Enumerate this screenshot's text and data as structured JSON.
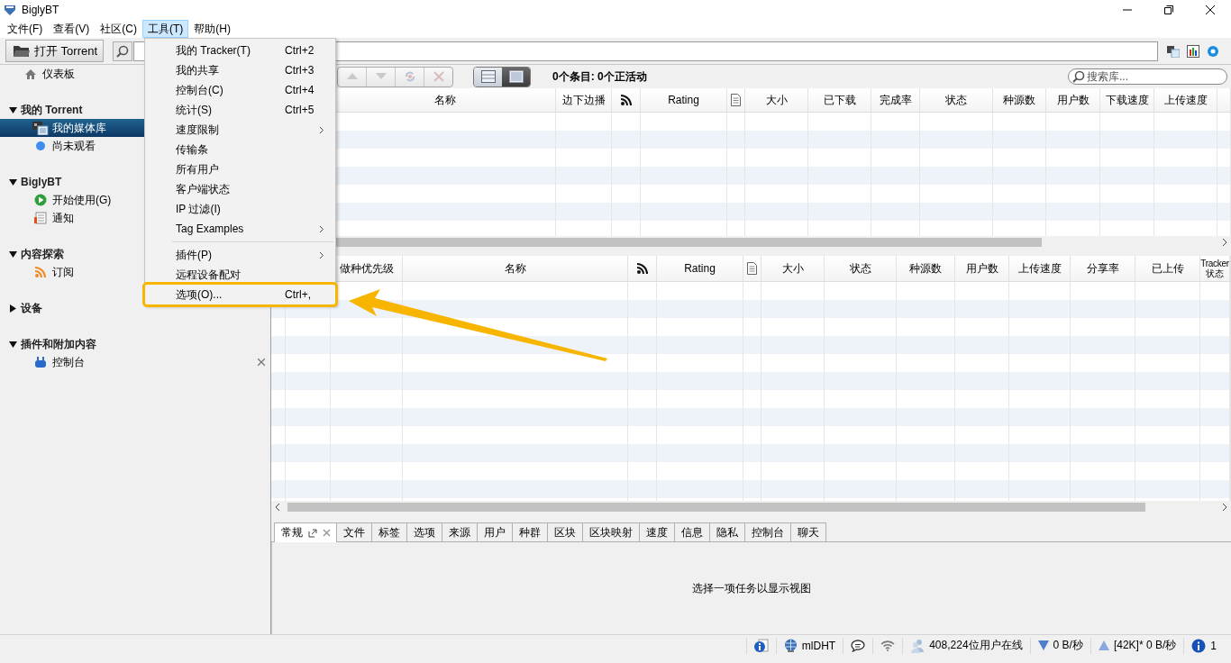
{
  "window": {
    "title": "BiglyBT"
  },
  "menubar": [
    {
      "label": "文件(F)",
      "selected": false
    },
    {
      "label": "查看(V)",
      "selected": false
    },
    {
      "label": "社区(C)",
      "selected": false
    },
    {
      "label": "工具(T)",
      "selected": true
    },
    {
      "label": "帮助(H)",
      "selected": false
    }
  ],
  "toolbar": {
    "open_button": "打开 Torrent"
  },
  "tools_menu": [
    {
      "kind": "item",
      "label": "我的 Tracker(T)",
      "shortcut": "Ctrl+2",
      "submenu": false,
      "annotated": false
    },
    {
      "kind": "item",
      "label": "我的共享",
      "shortcut": "Ctrl+3",
      "submenu": false,
      "annotated": false
    },
    {
      "kind": "item",
      "label": "控制台(C)",
      "shortcut": "Ctrl+4",
      "submenu": false,
      "annotated": false
    },
    {
      "kind": "item",
      "label": "统计(S)",
      "shortcut": "Ctrl+5",
      "submenu": false,
      "annotated": false
    },
    {
      "kind": "item",
      "label": "速度限制",
      "submenu": true,
      "annotated": false
    },
    {
      "kind": "item",
      "label": "传输条",
      "submenu": false,
      "annotated": false
    },
    {
      "kind": "item",
      "label": "所有用户",
      "submenu": false,
      "annotated": false
    },
    {
      "kind": "item",
      "label": "客户端状态",
      "submenu": false,
      "annotated": false
    },
    {
      "kind": "item",
      "label": "IP 过滤(I)",
      "submenu": false,
      "annotated": false
    },
    {
      "kind": "item",
      "label": "Tag Examples",
      "submenu": true,
      "annotated": false
    },
    {
      "kind": "separator"
    },
    {
      "kind": "item",
      "label": "插件(P)",
      "submenu": true,
      "annotated": false
    },
    {
      "kind": "item",
      "label": "远程设备配对",
      "submenu": false,
      "annotated": false
    },
    {
      "kind": "item",
      "label": "选项(O)...",
      "shortcut": "Ctrl+,",
      "submenu": false,
      "annotated": true
    }
  ],
  "sidebar": [
    {
      "kind": "item",
      "label": "仪表板",
      "selected": false
    },
    {
      "kind": "section",
      "label": "我的 Torrent",
      "expanded": true,
      "children": [
        {
          "label": "我的媒体库",
          "selected": true
        },
        {
          "label": "尚未观看",
          "selected": false
        }
      ]
    },
    {
      "kind": "section",
      "label": "BiglyBT",
      "expanded": true,
      "children": [
        {
          "label": "开始使用(G)",
          "selected": false
        },
        {
          "label": "通知",
          "selected": false
        }
      ]
    },
    {
      "kind": "section",
      "label": "内容探索",
      "expanded": true,
      "children": [
        {
          "label": "订阅",
          "selected": false
        }
      ]
    },
    {
      "kind": "section",
      "label": "设备",
      "expanded": false
    },
    {
      "kind": "section",
      "label": "插件和附加内容",
      "expanded": true,
      "children": [
        {
          "label": "控制台",
          "selected": false,
          "closable": true
        }
      ]
    }
  ],
  "library": {
    "view_modes": [
      {
        "selected": false
      },
      {
        "selected": true
      }
    ],
    "summary": "0个条目: 0个正活动",
    "search": {
      "placeholder": "搜索库..."
    }
  },
  "downloads_table": {
    "columns": [
      {
        "kind": "text",
        "label": "名称"
      },
      {
        "kind": "text",
        "label": "边下边播"
      },
      {
        "kind": "rss"
      },
      {
        "kind": "text",
        "label": "Rating"
      },
      {
        "kind": "document"
      },
      {
        "kind": "text",
        "label": "大小"
      },
      {
        "kind": "text",
        "label": "已下载"
      },
      {
        "kind": "text",
        "label": "完成率"
      },
      {
        "kind": "text",
        "label": "状态"
      },
      {
        "kind": "text",
        "label": "种源数"
      },
      {
        "kind": "text",
        "label": "用户数"
      },
      {
        "kind": "text",
        "label": "下载速度"
      },
      {
        "kind": "text",
        "label": "上传速度"
      }
    ]
  },
  "seeding_table": {
    "columns": [
      {
        "kind": "text",
        "label": "做种优先级"
      },
      {
        "kind": "text",
        "label": "名称"
      },
      {
        "kind": "rss"
      },
      {
        "kind": "text",
        "label": "Rating"
      },
      {
        "kind": "document"
      },
      {
        "kind": "text",
        "label": "大小"
      },
      {
        "kind": "text",
        "label": "状态"
      },
      {
        "kind": "text",
        "label": "种源数"
      },
      {
        "kind": "text",
        "label": "用户数"
      },
      {
        "kind": "text",
        "label": "上传速度"
      },
      {
        "kind": "text",
        "label": "分享率"
      },
      {
        "kind": "text",
        "label": "已上传"
      },
      {
        "kind": "text",
        "label": "Tracker 状态"
      }
    ]
  },
  "detail_tabs": [
    {
      "label": "常规",
      "selected": true
    },
    {
      "label": "文件",
      "selected": false
    },
    {
      "label": "标签",
      "selected": false
    },
    {
      "label": "选项",
      "selected": false
    },
    {
      "label": "来源",
      "selected": false
    },
    {
      "label": "用户",
      "selected": false
    },
    {
      "label": "种群",
      "selected": false
    },
    {
      "label": "区块",
      "selected": false
    },
    {
      "label": "区块映射",
      "selected": false
    },
    {
      "label": "速度",
      "selected": false
    },
    {
      "label": "信息",
      "selected": false
    },
    {
      "label": "隐私",
      "selected": false
    },
    {
      "label": "控制台",
      "selected": false
    },
    {
      "label": "聊天",
      "selected": false
    }
  ],
  "detail_message": "选择一项任务以显示视图",
  "status_bar": {
    "dht": "mlDHT",
    "users_online": "408,224位用户在线",
    "download_speed": "0 B/秒",
    "upload_speed": "[42K]* 0 B/秒",
    "notifications": "1"
  }
}
